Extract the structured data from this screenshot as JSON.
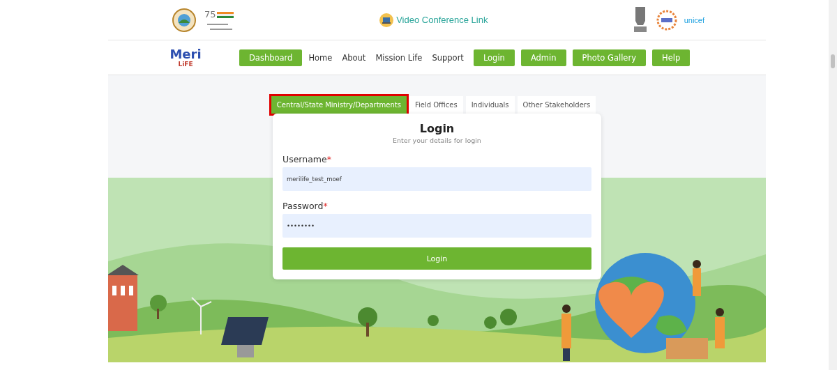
{
  "header": {
    "anniversary_logo_text": "75",
    "video_link": "Video Conference Link",
    "partner_logo_text": "unicef"
  },
  "nav": {
    "logo_title": "Meri",
    "logo_subtitle": "LiFE",
    "items": [
      {
        "label": "Dashboard",
        "kind": "button"
      },
      {
        "label": "Home",
        "kind": "link"
      },
      {
        "label": "About",
        "kind": "link"
      },
      {
        "label": "Mission Life",
        "kind": "link"
      },
      {
        "label": "Support",
        "kind": "link"
      },
      {
        "label": "Login",
        "kind": "button"
      },
      {
        "label": "Admin",
        "kind": "button"
      },
      {
        "label": "Photo Gallery",
        "kind": "button"
      },
      {
        "label": "Help",
        "kind": "button"
      }
    ]
  },
  "tabs": [
    {
      "label": "Central/State Ministry/Departments",
      "selected": true,
      "highlighted": true
    },
    {
      "label": "Field Offices",
      "selected": false,
      "highlighted": false
    },
    {
      "label": "Individuals",
      "selected": false,
      "highlighted": false
    },
    {
      "label": "Other Stakeholders",
      "selected": false,
      "highlighted": false
    }
  ],
  "login": {
    "title": "Login",
    "subtitle": "Enter your details for login",
    "fields": [
      {
        "label": "Username",
        "required": true,
        "required_mark": "*",
        "value": "merilife_test_moef"
      },
      {
        "label": "Password",
        "required": true,
        "required_mark": "*",
        "value": "••••••••"
      }
    ],
    "submit": "Login"
  }
}
